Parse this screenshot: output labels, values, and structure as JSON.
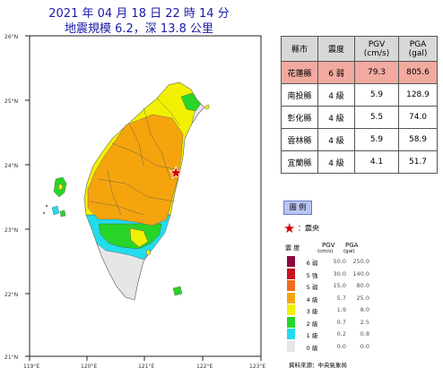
{
  "title_line1": "2021 年 04 月 18 日 22 時 14 分",
  "title_line2": "地震規模 6.2，深 13.8 公里",
  "map": {
    "lat_labels": [
      "26°N",
      "25°N",
      "24°N",
      "23°N",
      "22°N",
      "21°N"
    ],
    "lon_labels": [
      "119°E",
      "120°E",
      "121°E",
      "122°E",
      "123°E"
    ],
    "epicenter": {
      "lat": 23.86,
      "lon": 121.53
    }
  },
  "table": {
    "headers": [
      "縣市",
      "震度",
      "PGV\n(cm/s)",
      "PGA\n(gal)"
    ],
    "rows": [
      {
        "county": "花蓮縣",
        "intensity": "6 弱",
        "pgv": "79.3",
        "pga": "805.6"
      },
      {
        "county": "南投縣",
        "intensity": "4 級",
        "pgv": "5.9",
        "pga": "128.9"
      },
      {
        "county": "彰化縣",
        "intensity": "4 級",
        "pgv": "5.5",
        "pga": "74.0"
      },
      {
        "county": "雲林縣",
        "intensity": "4 級",
        "pgv": "5.9",
        "pga": "58.9"
      },
      {
        "county": "宜蘭縣",
        "intensity": "4 級",
        "pgv": "4.1",
        "pga": "51.7"
      }
    ]
  },
  "legend": {
    "button_label": "圖 例",
    "epicenter_label": "：震央",
    "head_intensity": "震 度",
    "head_pgv": "PGV",
    "head_pgv_unit": "(cm/s)",
    "head_pga": "PGA",
    "head_pga_unit": "(gal)",
    "levels": [
      {
        "label": "6 弱",
        "pgv": "50.0",
        "pga": "250.0",
        "color": "#8b0a3c"
      },
      {
        "label": "5 強",
        "pgv": "30.0",
        "pga": "140.0",
        "color": "#c8121e"
      },
      {
        "label": "5 弱",
        "pgv": "15.0",
        "pga": "80.0",
        "color": "#f06a18"
      },
      {
        "label": "4 級",
        "pgv": "5.7",
        "pga": "25.0",
        "color": "#f5a40e"
      },
      {
        "label": "3 級",
        "pgv": "1.9",
        "pga": "8.0",
        "color": "#f2f002"
      },
      {
        "label": "2 級",
        "pgv": "0.7",
        "pga": "2.5",
        "color": "#28d428"
      },
      {
        "label": "1 級",
        "pgv": "0.2",
        "pga": "0.8",
        "color": "#22dcec"
      },
      {
        "label": "0 級",
        "pgv": "0.0",
        "pga": "0.0",
        "color": "#e6e6e6"
      }
    ],
    "source": "資料來源：中央氣象局"
  }
}
